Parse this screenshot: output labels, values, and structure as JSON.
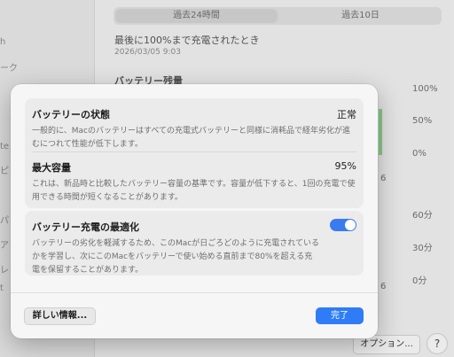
{
  "background": {
    "sidebar_fragments": [
      "h",
      "ーク",
      "te",
      "ピ",
      "パ",
      "ア",
      "レ",
      "t"
    ],
    "segments": [
      "過去24時間",
      "過去10日"
    ],
    "last_full_charge_heading": "最後に100%まで充電されたとき",
    "last_full_charge_date": "2026/03/05 9:03",
    "battery_level_heading": "バッテリー残量",
    "level_ticks": [
      "100%",
      "50%",
      "0%"
    ],
    "usage_ticks": [
      "60分",
      "30分",
      "0分"
    ],
    "axis_fragments": [
      "6",
      "6"
    ],
    "options_button": "オプション...",
    "help_button": "?"
  },
  "sheet": {
    "health": {
      "title": "バッテリーの状態",
      "value": "正常",
      "description": "一般的に、Macのバッテリーはすべての充電式バッテリーと同様に消耗品で経年劣化が進むにつれて性能が低下します。"
    },
    "capacity": {
      "title": "最大容量",
      "value": "95%",
      "description": "これは、新品時と比較したバッテリー容量の基準です。容量が低下すると、1回の充電で使用できる時間が短くなることがあります。"
    },
    "optimize": {
      "title": "バッテリー充電の最適化",
      "enabled": true,
      "description": "バッテリーの劣化を軽減するため、このMacが日ごろどのように充電されているかを学習し、次にこのMacをバッテリーで使い始める直前まで80%を超える充電を保留することがあります。"
    },
    "more_info_button": "詳しい情報...",
    "done_button": "完了"
  },
  "colors": {
    "accent": "#2f7cf6",
    "toggle_on": "#3a7bf0",
    "chart_green": "#8fd08f"
  }
}
